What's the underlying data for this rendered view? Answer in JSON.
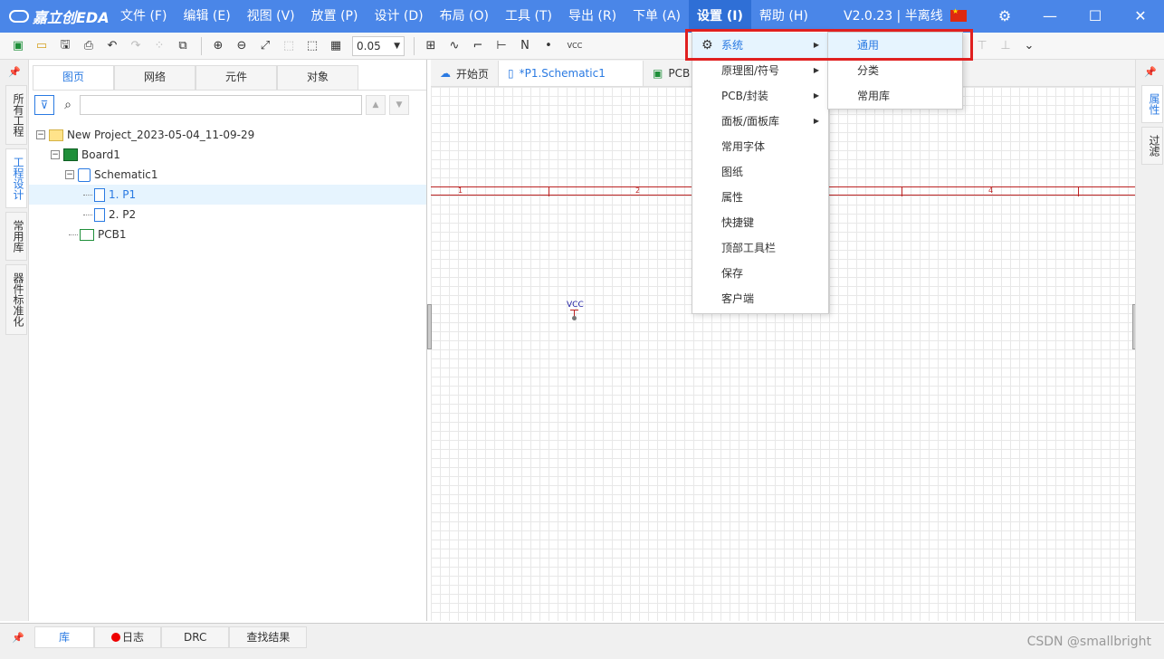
{
  "app": {
    "logo_text": "嘉立创EDA",
    "version": "V2.0.23 | 半离线"
  },
  "menubar": [
    {
      "label": "文件 (F)"
    },
    {
      "label": "编辑 (E)"
    },
    {
      "label": "视图 (V)"
    },
    {
      "label": "放置 (P)"
    },
    {
      "label": "设计 (D)"
    },
    {
      "label": "布局 (O)"
    },
    {
      "label": "工具 (T)"
    },
    {
      "label": "导出 (R)"
    },
    {
      "label": "下单 (A)"
    },
    {
      "label": "设置 (I)"
    },
    {
      "label": "帮助 (H)"
    }
  ],
  "toolbar": {
    "grid_value": "0.05",
    "vcc_label": "VCC"
  },
  "left_vtabs": [
    "所有工程",
    "工程设计",
    "常用库",
    "器件标准化"
  ],
  "panel_tabs": [
    "图页",
    "网络",
    "元件",
    "对象"
  ],
  "search": {
    "value": "",
    "placeholder": ""
  },
  "tree": {
    "project": "New Project_2023-05-04_11-09-29",
    "board": "Board1",
    "schematic": "Schematic1",
    "page1": "1. P1",
    "page2": "2. P2",
    "pcb": "PCB1"
  },
  "doc_tabs": [
    "开始页",
    "*P1.Schematic1",
    "PCB"
  ],
  "canvas": {
    "frame_numbers": [
      "1",
      "2",
      "4"
    ],
    "vcc_net": "VCC"
  },
  "right_vtabs": [
    "属性",
    "过滤"
  ],
  "bottom_tabs": [
    "库",
    "日志",
    "DRC",
    "查找结果"
  ],
  "settings_menu": [
    "系统",
    "原理图/符号",
    "PCB/封装",
    "面板/面板库",
    "常用字体",
    "图纸",
    "属性",
    "快捷键",
    "顶部工具栏",
    "保存",
    "客户端"
  ],
  "system_submenu": [
    "通用",
    "分类",
    "常用库"
  ],
  "watermark": "CSDN @smallbright",
  "colors": {
    "title_bar": "#4a86e8",
    "accent": "#2a7ae2",
    "highlight_box": "#e02020"
  }
}
